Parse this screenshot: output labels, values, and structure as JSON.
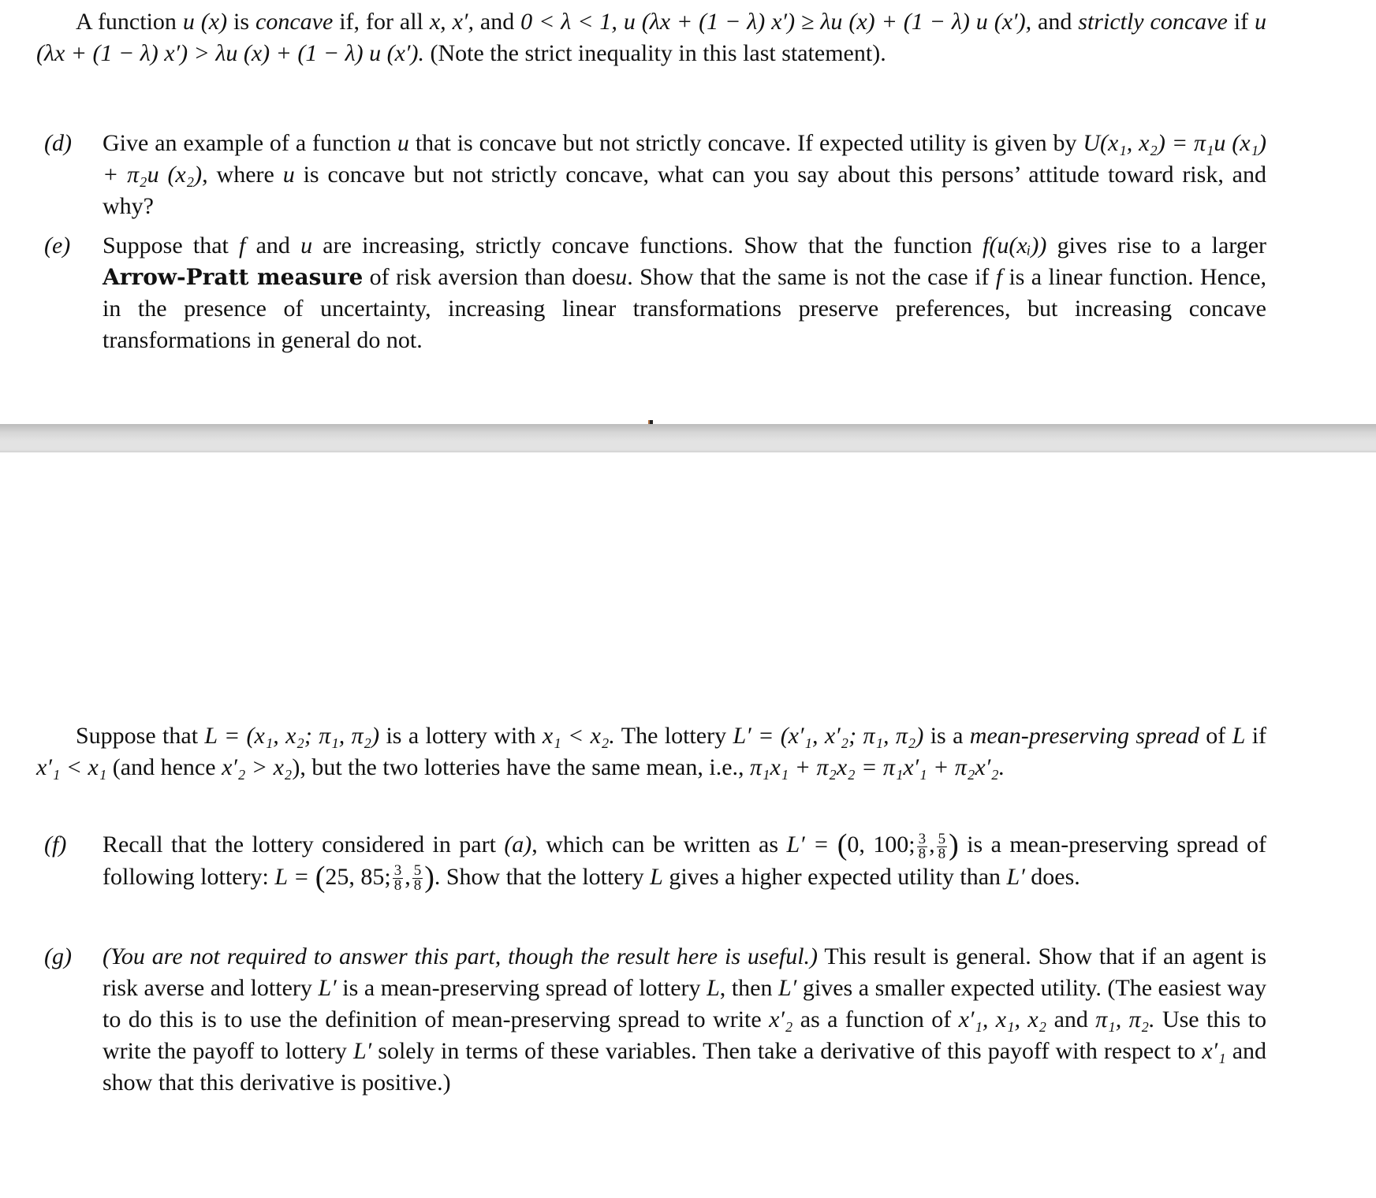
{
  "document": {
    "top_page": {
      "definition_paragraph": {
        "intro": "A function",
        "func": "u (x)",
        "is": "is",
        "concave_term": "concave",
        "cond1": "if, for all",
        "vars": "x, x′,",
        "and": "and",
        "lambda_range": "0 < λ < 1,",
        "ineq_weak": "u (λx + (1 − λ) x′) ≥ λu (x) + (1 − λ) u (x′),",
        "and2": "and",
        "strictly_term": "strictly concave",
        "if": "if",
        "ineq_strict": "u (λx + (1 − λ) x′) > λu (x) + (1 − λ) u (x′).",
        "note": "(Note the strict inequality in this last statement)."
      },
      "item_d": {
        "label": "(d)",
        "t1": "Give an example of a function",
        "u": "u",
        "t2": "that is concave but not strictly concave. If expected utility is given by",
        "eq": "U(x₁, x₂) = π₁u (x₁) + π₂u (x₂),",
        "t3": "where",
        "t4": "is concave but not strictly concave, what can you say about this persons’ attitude toward risk, and why?"
      },
      "item_e": {
        "label": "(e)",
        "t1": "Suppose that",
        "f": "f",
        "t2": "and",
        "u": "u",
        "t3": "are increasing, strictly concave functions. Show that the function",
        "fu": "f(u(xᵢ))",
        "t4": "gives rise to a larger",
        "bold": "Arrow-Pratt measure",
        "t5": "of risk aversion than does",
        "t6": ". Show that the same is not the case if",
        "t7": "is a linear function. Hence, in the presence of uncertainty, increasing linear transformations preserve preferences, but increasing concave transformations in general do not."
      }
    },
    "bottom_page": {
      "mps_paragraph": {
        "t1": "Suppose that",
        "L_def": "L = (x₁, x₂; π₁, π₂)",
        "t2": "is a lottery with",
        "cond": "x₁ < x₂.",
        "t3": "The lottery",
        "Lp_def": "L′ = (x′₁, x′₂; π₁, π₂)",
        "t4": "is a",
        "term": "mean-preserving spread",
        "t5": "of",
        "L": "L",
        "t6": "if",
        "c1": "x′₁ < x₁",
        "t7": "(and hence",
        "c2": "x′₂ > x₂",
        "t8": "), but the two lotteries have the same mean, i.e.,",
        "eq": "π₁x₁ + π₂x₂ = π₁x′₁ + π₂x′₂."
      },
      "item_f": {
        "label": "(f)",
        "t1": "Recall that the lottery considered in part",
        "part": "(a)",
        "t2": ", which can be written as",
        "Lp": "L′ =",
        "Lp_vals": "0, 100;",
        "t3": "is a mean-preserving spread of following lottery:",
        "L": "L =",
        "L_vals": "25, 85;",
        "frac1_num": "3",
        "frac1_den": "8",
        "frac2_num": "5",
        "frac2_den": "8",
        "t4": ". Show that the lottery",
        "t5": "gives a higher expected utility than",
        "t6": "does."
      },
      "item_g": {
        "label": "(g)",
        "italic": "(You are not required to answer this part, though the result here is useful.)",
        "t1": "This result is general. Show that if an agent is risk averse and lottery",
        "Lp": "L′",
        "t2": "is a mean-preserving spread of lottery",
        "L": "L",
        "t3": ", then",
        "t4": "gives a smaller expected utility. (The easiest way to do this is to use the definition of mean-preserving spread to write",
        "x2p": "x′₂",
        "t5": "as a function of",
        "vars": "x′₁, x₁, x₂",
        "t6": "and",
        "pis": "π₁, π₂.",
        "t7": "Use this to write the payoff to lottery",
        "t8": "solely in terms of these variables. Then take a derivative of this payoff with respect to",
        "x1p": "x′₁",
        "t9": "and show that this derivative is positive.)"
      }
    }
  }
}
